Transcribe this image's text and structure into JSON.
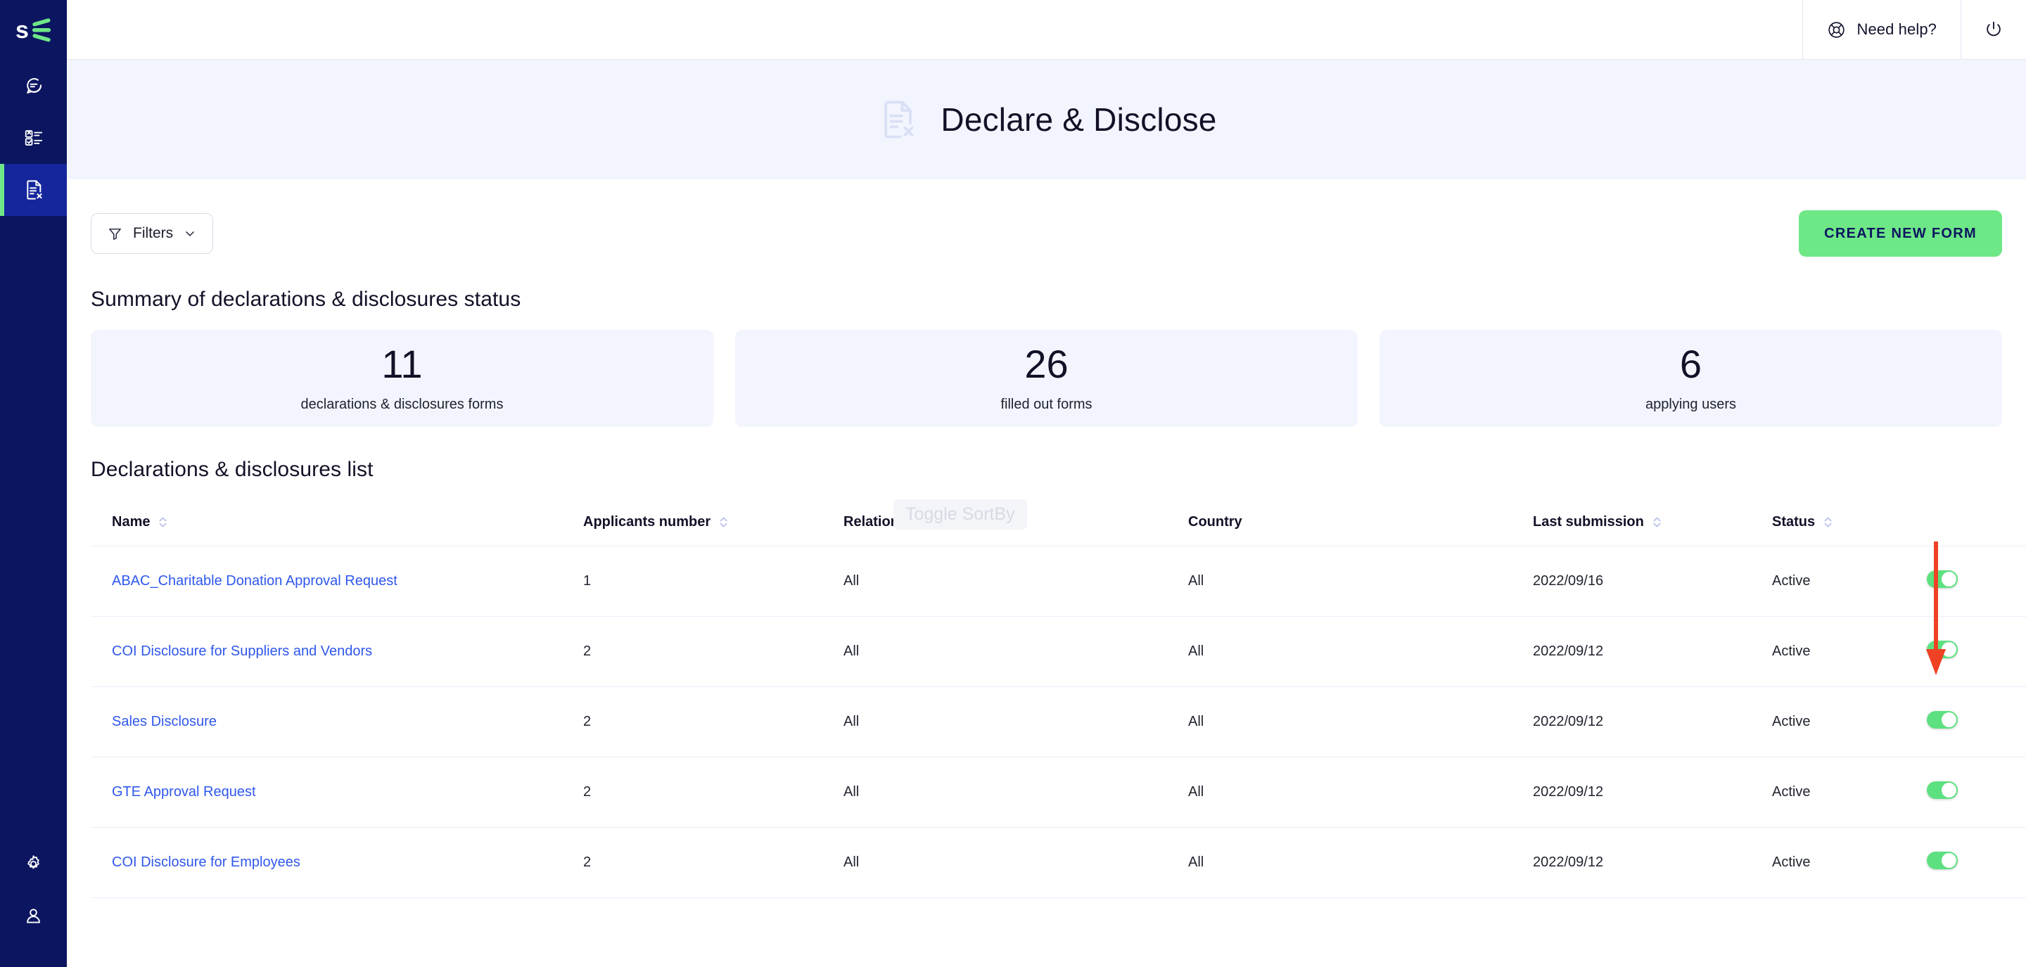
{
  "brand": {
    "logo_text": "s",
    "logo_icon": "sharp-logo-icon"
  },
  "sidebar": {
    "items": [
      {
        "id": "messages",
        "icon": "chat-bubble-icon",
        "active": false
      },
      {
        "id": "tasks",
        "icon": "checklist-icon",
        "active": false
      },
      {
        "id": "declare",
        "icon": "document-x-icon",
        "active": true
      }
    ],
    "bottom_items": [
      {
        "id": "settings",
        "icon": "gear-icon"
      },
      {
        "id": "account",
        "icon": "user-icon"
      }
    ]
  },
  "topbar": {
    "help_label": "Need help?",
    "help_icon": "lifebuoy-icon",
    "power_icon": "power-icon"
  },
  "header": {
    "title": "Declare & Disclose",
    "icon": "document-x-icon"
  },
  "toolbar": {
    "filters_label": "Filters",
    "filters_icon": "funnel-icon",
    "filters_chevron": "chevron-down-icon",
    "create_label": "CREATE NEW FORM"
  },
  "tooltip": {
    "sortby": "Toggle SortBy"
  },
  "summary": {
    "title": "Summary of declarations & disclosures status",
    "cards": [
      {
        "value": "11",
        "caption": "declarations & disclosures forms"
      },
      {
        "value": "26",
        "caption": "filled out forms"
      },
      {
        "value": "6",
        "caption": "applying users"
      }
    ]
  },
  "list": {
    "title": "Declarations & disclosures list",
    "columns": [
      {
        "key": "name",
        "label": "Name",
        "sortable": true
      },
      {
        "key": "applicants",
        "label": "Applicants number",
        "sortable": true
      },
      {
        "key": "relation",
        "label": "Relationship",
        "sortable": false
      },
      {
        "key": "country",
        "label": "Country",
        "sortable": false
      },
      {
        "key": "last",
        "label": "Last submission",
        "sortable": true
      },
      {
        "key": "status",
        "label": "Status",
        "sortable": true
      },
      {
        "key": "toggle",
        "label": "",
        "sortable": false
      }
    ],
    "rows": [
      {
        "name": "ABAC_Charitable Donation Approval Request",
        "applicants": "1",
        "relation": "All",
        "country": "All",
        "last": "2022/09/16",
        "status": "Active",
        "enabled": true
      },
      {
        "name": "COI Disclosure for Suppliers and Vendors",
        "applicants": "2",
        "relation": "All",
        "country": "All",
        "last": "2022/09/12",
        "status": "Active",
        "enabled": true
      },
      {
        "name": "Sales Disclosure",
        "applicants": "2",
        "relation": "All",
        "country": "All",
        "last": "2022/09/12",
        "status": "Active",
        "enabled": true
      },
      {
        "name": "GTE Approval Request",
        "applicants": "2",
        "relation": "All",
        "country": "All",
        "last": "2022/09/12",
        "status": "Active",
        "enabled": true
      },
      {
        "name": "COI Disclosure for Employees",
        "applicants": "2",
        "relation": "All",
        "country": "All",
        "last": "2022/09/12",
        "status": "Active",
        "enabled": true
      }
    ]
  },
  "annotation": {
    "arrow": "red-down-arrow",
    "color": "#ef4123"
  },
  "colors": {
    "sidebar_bg": "#0b1560",
    "sidebar_active_bg": "#15269c",
    "accent_green": "#6ee787",
    "toggle_green": "#5ce080",
    "band_bg": "#f2f5fd",
    "link_blue": "#2f57ec",
    "text_dark": "#121127"
  }
}
